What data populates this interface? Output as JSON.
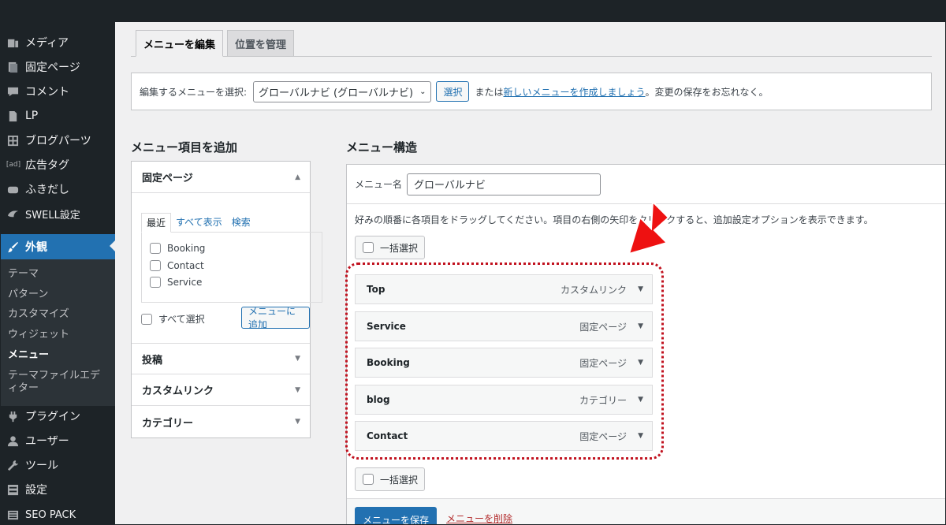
{
  "sidebar": {
    "items": [
      {
        "label": "メディア",
        "icon": "media-icon"
      },
      {
        "label": "固定ページ",
        "icon": "page-icon"
      },
      {
        "label": "コメント",
        "icon": "comment-icon"
      },
      {
        "label": "LP",
        "icon": "document-icon"
      },
      {
        "label": "ブログパーツ",
        "icon": "grid-icon"
      },
      {
        "label": "広告タグ",
        "icon": "ad-icon",
        "icon_text": "[ad]"
      },
      {
        "label": "ふきだし",
        "icon": "balloon-icon"
      },
      {
        "label": "SWELL設定",
        "icon": "swell-icon"
      },
      {
        "label": "外観",
        "icon": "brush-icon",
        "active": true
      },
      {
        "label": "プラグイン",
        "icon": "plugin-icon"
      },
      {
        "label": "ユーザー",
        "icon": "user-icon"
      },
      {
        "label": "ツール",
        "icon": "wrench-icon"
      },
      {
        "label": "設定",
        "icon": "settings-icon"
      },
      {
        "label": "SEO PACK",
        "icon": "seo-icon"
      }
    ],
    "submenu": [
      "テーマ",
      "パターン",
      "カスタマイズ",
      "ウィジェット",
      "メニュー",
      "テーマファイルエディター"
    ],
    "submenu_current": "メニュー"
  },
  "tabs": [
    "メニューを編集",
    "位置を管理"
  ],
  "select_bar": {
    "label": "編集するメニューを選択:",
    "selected": "グローバルナビ (グローバルナビ)",
    "select_button": "選択",
    "text_before": "または",
    "create_link": "新しいメニューを作成しましょう",
    "text_after": "。変更の保存をお忘れなく。"
  },
  "add_items": {
    "title": "メニュー項目を追加",
    "sections": [
      "固定ページ",
      "投稿",
      "カスタムリンク",
      "カテゴリー"
    ],
    "inner_tabs": [
      "最近",
      "すべて表示",
      "検索"
    ],
    "pages": [
      "Booking",
      "Contact",
      "Service"
    ],
    "select_all": "すべて選択",
    "add_button": "メニューに追加"
  },
  "structure": {
    "title": "メニュー構造",
    "name_label": "メニュー名",
    "name_value": "グローバルナビ",
    "instructions": "好みの順番に各項目をドラッグしてください。項目の右側の矢印をクリックすると、追加設定オプションを表示できます。",
    "bulk_select": "一括選択",
    "items": [
      {
        "title": "Top",
        "type": "カスタムリンク"
      },
      {
        "title": "Service",
        "type": "固定ページ"
      },
      {
        "title": "Booking",
        "type": "固定ページ"
      },
      {
        "title": "blog",
        "type": "カテゴリー"
      },
      {
        "title": "Contact",
        "type": "固定ページ"
      }
    ],
    "save_button": "メニューを保存",
    "delete_link": "メニューを削除"
  },
  "colors": {
    "admin_dark": "#1d2327",
    "accent_blue": "#2271b1",
    "highlight_red": "#c1121f",
    "arrow_red": "#ee1111"
  }
}
